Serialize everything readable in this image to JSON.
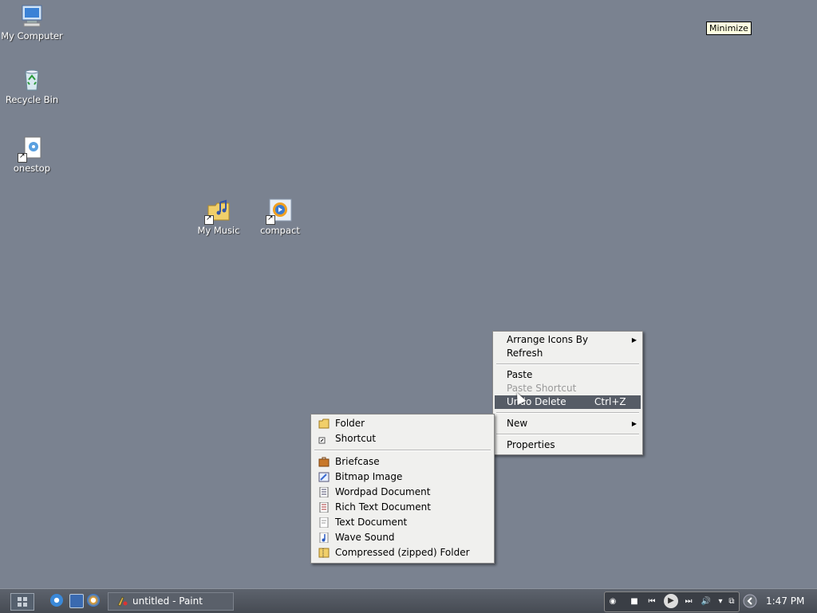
{
  "desktop": {
    "icons": [
      {
        "label": "My Computer",
        "icon": "computer-icon"
      },
      {
        "label": "Recycle Bin",
        "icon": "recycle-bin-icon"
      },
      {
        "label": "onestop",
        "icon": "shortcut-media-icon"
      },
      {
        "label": "My Music",
        "icon": "music-folder-icon"
      },
      {
        "label": "compact",
        "icon": "media-player-icon"
      }
    ]
  },
  "tooltip": {
    "text": "Minimize"
  },
  "context_menu": {
    "items": [
      {
        "label": "Arrange Icons By",
        "has_submenu": true
      },
      {
        "label": "Refresh"
      },
      {
        "label": "Paste"
      },
      {
        "label": "Paste Shortcut",
        "disabled": true
      },
      {
        "label": "Undo Delete",
        "shortcut": "Ctrl+Z",
        "highlighted": true
      },
      {
        "label": "New",
        "has_submenu": true
      },
      {
        "label": "Properties"
      }
    ]
  },
  "new_submenu": {
    "items": [
      {
        "label": "Folder",
        "icon": "folder-icon"
      },
      {
        "label": "Shortcut",
        "icon": "shortcut-icon"
      },
      {
        "label": "Briefcase",
        "icon": "briefcase-icon"
      },
      {
        "label": "Bitmap Image",
        "icon": "bitmap-icon"
      },
      {
        "label": "Wordpad Document",
        "icon": "wordpad-icon"
      },
      {
        "label": "Rich Text Document",
        "icon": "rtf-icon"
      },
      {
        "label": "Text Document",
        "icon": "text-doc-icon"
      },
      {
        "label": "Wave Sound",
        "icon": "wave-sound-icon"
      },
      {
        "label": "Compressed (zipped) Folder",
        "icon": "zip-folder-icon"
      }
    ]
  },
  "taskbar": {
    "task_button": "untitled - Paint",
    "clock": "1:47 PM"
  },
  "colors": {
    "desktop": "#7a8290",
    "menu_highlight": "#565c66"
  }
}
